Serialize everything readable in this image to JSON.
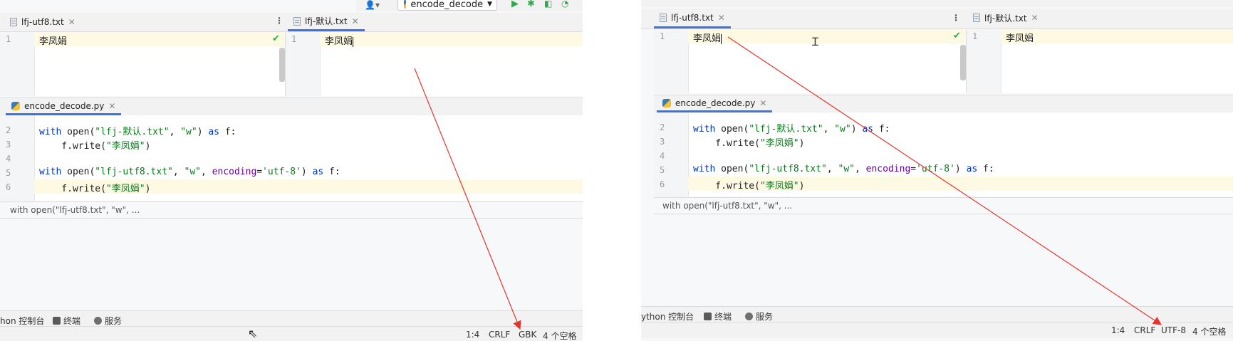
{
  "left": {
    "toolbar": {
      "run_config": "encode_decode",
      "user_icon": "user-icon",
      "run_icon": "run-icon",
      "debug_icon": "debug-icon",
      "coverage_icon": "coverage-icon",
      "profile_icon": "profile-icon"
    },
    "tabs_a": {
      "label": "lfj-utf8.txt"
    },
    "tabs_b": {
      "label": "lfj-默认.txt"
    },
    "editor_a": {
      "line_no": "1",
      "text": "李凤娟"
    },
    "editor_b": {
      "line_no": "1",
      "text": "李凤娟"
    },
    "py_tab": {
      "label": "encode_decode.py"
    },
    "code": {
      "line_numbers": [
        "2",
        "3",
        "4",
        "5",
        "6"
      ],
      "l2_kw1": "with",
      "l2_fn": " open(",
      "l2_str1": "\"lfj-默认.txt\"",
      "l2_sep": ", ",
      "l2_str2": "\"w\"",
      "l2_close": ") ",
      "l2_kw2": "as",
      "l2_end": " f:",
      "l3_fn": "    f.write(",
      "l3_str": "\"李凤娟\"",
      "l3_end": ")",
      "l5_kw1": "with",
      "l5_fn": " open(",
      "l5_str1": "\"lfj-utf8.txt\"",
      "l5_sep": ", ",
      "l5_str2": "\"w\"",
      "l5_sep2": ", ",
      "l5_param": "encoding",
      "l5_eq": "=",
      "l5_str3": "'utf-8'",
      "l5_close": ") ",
      "l5_kw2": "as",
      "l5_end": " f:",
      "l6_fn": "    f.write(",
      "l6_str": "\"李凤娟\"",
      "l6_end": ")"
    },
    "breadcrumb": "with open(\"lfj-utf8.txt\", \"w\", ...",
    "toolwindows": {
      "console": "hon 控制台",
      "terminal": "终端",
      "services": "服务"
    },
    "status": {
      "position": "1:4",
      "line_sep": "CRLF",
      "encoding": "GBK",
      "indent": "4 个空格"
    }
  },
  "right": {
    "tabs_a": {
      "label": "lfj-utf8.txt"
    },
    "tabs_b": {
      "label": "lfj-默认.txt"
    },
    "editor_a": {
      "line_no": "1",
      "text": "李凤娟"
    },
    "editor_b": {
      "line_no": "1",
      "text": "李凤娟"
    },
    "py_tab": {
      "label": "encode_decode.py"
    },
    "code": {
      "line_numbers": [
        "2",
        "3",
        "4",
        "5",
        "6"
      ],
      "l2_kw1": "with",
      "l2_fn": " open(",
      "l2_str1": "\"lfj-默认.txt\"",
      "l2_sep": ", ",
      "l2_str2": "\"w\"",
      "l2_close": ") ",
      "l2_kw2": "as",
      "l2_end": " f:",
      "l3_fn": "    f.write(",
      "l3_str": "\"李凤娟\"",
      "l3_end": ")",
      "l5_kw1": "with",
      "l5_fn": " open(",
      "l5_str1": "\"lfj-utf8.txt\"",
      "l5_sep": ", ",
      "l5_str2": "\"w\"",
      "l5_sep2": ", ",
      "l5_param": "encoding",
      "l5_eq": "=",
      "l5_str3": "'utf-8'",
      "l5_close": ") ",
      "l5_kw2": "as",
      "l5_end": " f:",
      "l6_fn": "    f.write(",
      "l6_str": "\"李凤娟\"",
      "l6_end": ")"
    },
    "breadcrumb": "with open(\"lfj-utf8.txt\", \"w\", ...",
    "toolwindows": {
      "console": "ython 控制台",
      "terminal": "终端",
      "services": "服务"
    },
    "status": {
      "position": "1:4",
      "line_sep": "CRLF",
      "encoding": "UTF-8",
      "indent": "4 个空格"
    }
  },
  "colors": {
    "accent": "#3574f0",
    "annotation": "#e8322c",
    "keyword": "#0033b3",
    "string": "#067d17"
  }
}
